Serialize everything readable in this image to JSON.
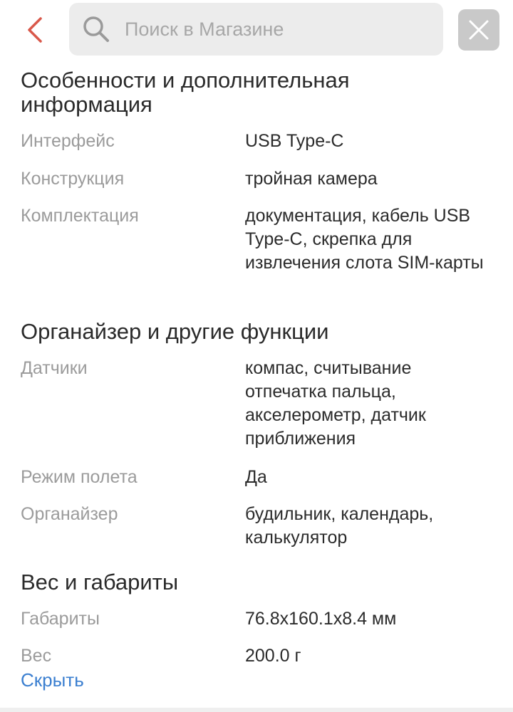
{
  "header": {
    "search_placeholder": "Поиск в Магазине"
  },
  "sections": [
    {
      "title": "Особенности и дополнительная информация",
      "rows": [
        {
          "label": "Интерфейс",
          "value": "USB Type-C"
        },
        {
          "label": "Конструкция",
          "value": "тройная камера"
        },
        {
          "label": "Комплектация",
          "value": "документация, кабель USB Type-C, скрепка для извлечения слота SIM-карты"
        }
      ]
    },
    {
      "title": "Органайзер и другие функции",
      "rows": [
        {
          "label": "Датчики",
          "value": "компас, считывание отпечатка пальца, акселерометр, датчик приближения"
        },
        {
          "label": "Режим полета",
          "value": "Да"
        },
        {
          "label": "Органайзер",
          "value": "будильник, календарь, калькулятор"
        }
      ]
    },
    {
      "title": "Вес и габариты",
      "rows": [
        {
          "label": "Габариты",
          "value": "76.8x160.1x8.4 мм"
        },
        {
          "label": "Вес",
          "value": "200.0 г"
        }
      ]
    }
  ],
  "hide_link": "Скрыть",
  "colors": {
    "accent": "#d9584a",
    "link": "#3b7fd0",
    "label": "#9b9b9b",
    "search_bg": "#ececec",
    "close_bg": "#c9c9c9"
  },
  "icons": {
    "back": "chevron-left-icon",
    "search": "search-icon",
    "close": "close-icon"
  }
}
